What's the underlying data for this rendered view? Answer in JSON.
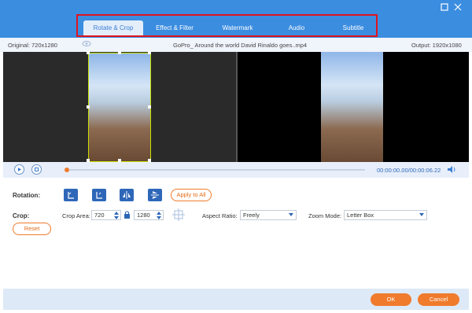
{
  "tabs": [
    {
      "label": "Rotate & Crop",
      "active": true
    },
    {
      "label": "Effect & Filter",
      "active": false
    },
    {
      "label": "Watermark",
      "active": false
    },
    {
      "label": "Audio",
      "active": false
    },
    {
      "label": "Subtitle",
      "active": false
    }
  ],
  "info": {
    "original": "Original: 720x1280",
    "filename": "GoPro_ Around the world David Rinaldo goes..mp4",
    "output": "Output: 1920x1080"
  },
  "player": {
    "time": "00:00:00.00/00:00:06.22",
    "progress": 0.0
  },
  "rotation": {
    "label": "Rotation:",
    "apply_all": "Apply to All"
  },
  "crop": {
    "label": "Crop:",
    "area_label": "Crop Area:",
    "width": "720",
    "height": "1280",
    "aspect_label": "Aspect Ratio:",
    "aspect_value": "Freely",
    "zoom_label": "Zoom Mode:",
    "zoom_value": "Letter Box",
    "reset": "Reset"
  },
  "footer": {
    "ok": "OK",
    "cancel": "Cancel"
  },
  "colors": {
    "accent": "#3b8de0",
    "highlight": "#e0141e",
    "action": "#f07b2c"
  }
}
